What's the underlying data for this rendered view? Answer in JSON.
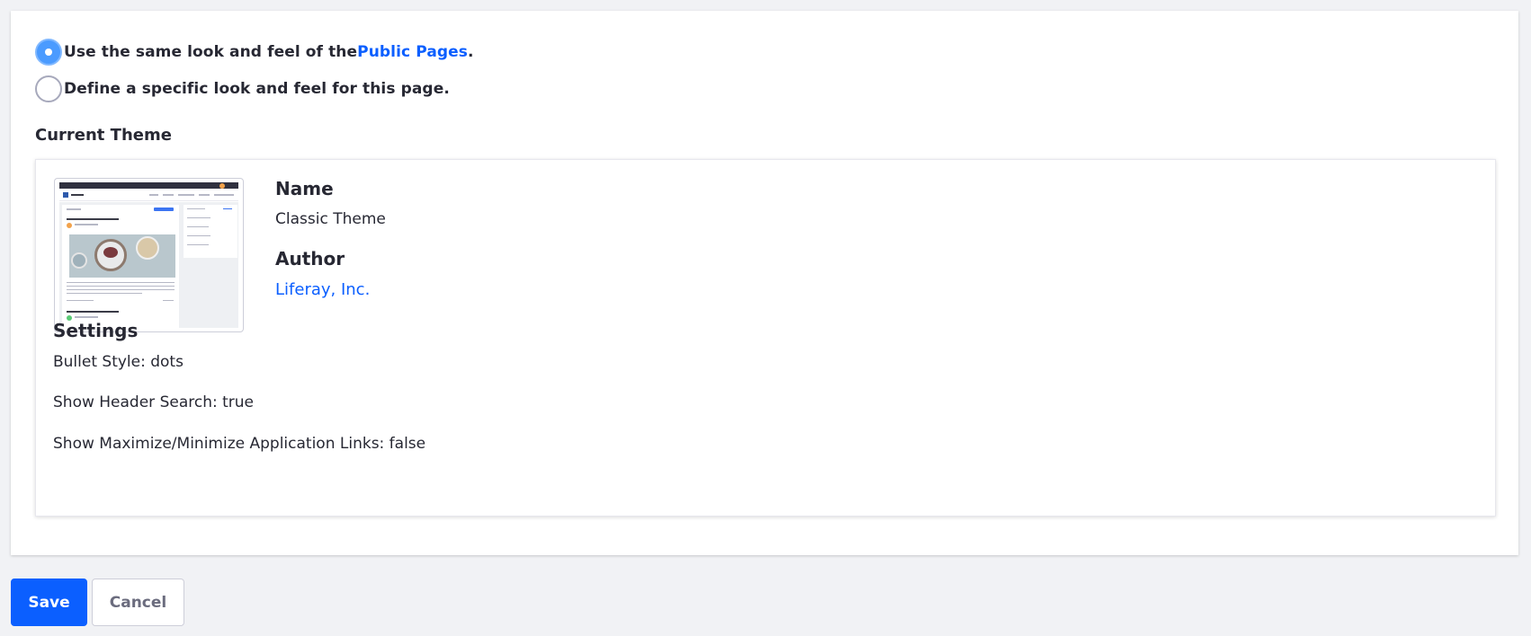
{
  "look_and_feel": {
    "option_public": {
      "prefix": "Use the same look and feel of the ",
      "link": "Public Pages",
      "suffix": ".",
      "selected": true
    },
    "option_specific": {
      "label": "Define a specific look and feel for this page.",
      "selected": false
    }
  },
  "current_theme": {
    "heading": "Current Theme",
    "name_label": "Name",
    "name_value": "Classic Theme",
    "author_label": "Author",
    "author_value": "Liferay, Inc.",
    "settings_heading": "Settings",
    "settings": [
      "Bullet Style: dots",
      "Show Header Search: true",
      "Show Maximize/Minimize Application Links: false"
    ]
  },
  "actions": {
    "save": "Save",
    "cancel": "Cancel"
  },
  "colors": {
    "primary": "#0b5fff",
    "radio_selected": "#4b9bff",
    "page_background": "#f1f2f5"
  },
  "icons": [
    "radio-selected-icon",
    "radio-unselected-icon",
    "theme-thumbnail"
  ]
}
